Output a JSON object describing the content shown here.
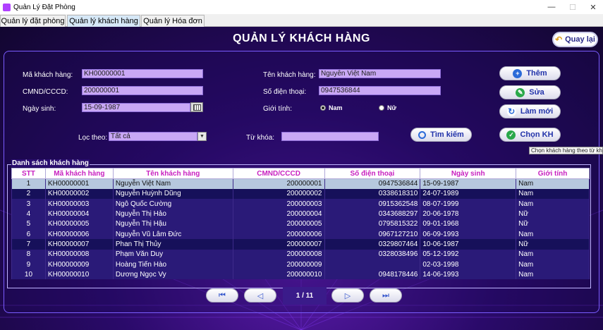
{
  "window": {
    "title": "Quản Lý Đặt Phòng",
    "minimize": "—",
    "maximize": "☐",
    "close": "✕"
  },
  "tabs": [
    "Quản lý đặt phòng",
    "Quản lý khách hàng",
    "Quản lý Hóa đơn"
  ],
  "page": {
    "title": "QUẢN LÝ KHÁCH HÀNG",
    "back_label": "Quay lại"
  },
  "form": {
    "ma_kh_label": "Mã khách hàng:",
    "ma_kh_value": "KH00000001",
    "cmnd_label": "CMND/CCCD:",
    "cmnd_value": "200000001",
    "ngay_sinh_label": "Ngày sinh:",
    "ngay_sinh_value": "15-09-1987",
    "ten_kh_label": "Tên khách hàng:",
    "ten_kh_value": "Nguyễn Việt Nam",
    "sdt_label": "Số điện thoại:",
    "sdt_value": "0947536844",
    "gioi_tinh_label": "Giới tính:",
    "gioi_tinh_nam": "Nam",
    "gioi_tinh_nu": "Nữ",
    "gioi_tinh_selected": "Nam",
    "loc_label": "Lọc theo:",
    "loc_value": "Tất cả",
    "tu_khoa_label": "Từ khóa:",
    "tu_khoa_value": ""
  },
  "buttons": {
    "them": "Thêm",
    "sua": "Sửa",
    "lam_moi": "Làm mới",
    "chon_kh": "Chọn KH",
    "tim_kiem": "Tìm kiếm"
  },
  "tooltip": "Chọn khách hàng theo từ khóa",
  "table": {
    "title": "Danh sách khách hàng",
    "headers": [
      "STT",
      "Mã khách hàng",
      "Tên khách hàng",
      "CMND/CCCD",
      "Số điện thoại",
      "Ngày sinh",
      "Giới tính"
    ],
    "rows": [
      [
        "1",
        "KH00000001",
        "Nguyễn Việt Nam",
        "200000001",
        "0947536844",
        "15-09-1987",
        "Nam"
      ],
      [
        "2",
        "KH00000002",
        "Nguyễn Huỳnh Dũng",
        "200000002",
        "0338618310",
        "24-07-1989",
        "Nam"
      ],
      [
        "3",
        "KH00000003",
        "Ngô Quốc Cường",
        "200000003",
        "0915362548",
        "08-07-1999",
        "Nam"
      ],
      [
        "4",
        "KH00000004",
        "Nguyễn Thị Hảo",
        "200000004",
        "0343688297",
        "20-06-1978",
        "Nữ"
      ],
      [
        "5",
        "KH00000005",
        "Nguyễn Thị Hậu",
        "200000005",
        "0795815322",
        "09-01-1968",
        "Nữ"
      ],
      [
        "6",
        "KH00000006",
        "Nguyễn Vũ Lâm Đức",
        "200000006",
        "0967127210",
        "06-09-1993",
        "Nam"
      ],
      [
        "7",
        "KH00000007",
        "Phan Thị Thủy",
        "200000007",
        "0329807464",
        "10-06-1987",
        "Nữ"
      ],
      [
        "8",
        "KH00000008",
        "Phạm Văn Duy",
        "200000008",
        "0328038496",
        "05-12-1992",
        "Nam"
      ],
      [
        "9",
        "KH00000009",
        "Hoàng Tiến Hào",
        "200000009",
        "",
        "02-03-1998",
        "Nam"
      ],
      [
        "10",
        "KH00000010",
        "Dương Ngọc Vy",
        "200000010",
        "0948178446",
        "14-06-1993",
        "Nam"
      ]
    ]
  },
  "pager": {
    "first": "⏮",
    "prev": "◁",
    "indicator": "1 / 11",
    "next": "▷",
    "last": "⏭"
  }
}
